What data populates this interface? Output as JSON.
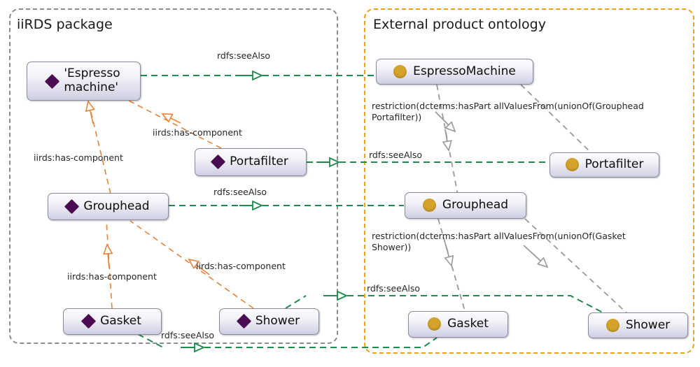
{
  "diagram": {
    "title": "iiRDS package and external product ontology mapping",
    "colors": {
      "iirds_package_border": "#8c8c8c",
      "external_package_border": "#e8a317",
      "see_also_edge": "#1f8b4d",
      "has_component_edge": "#e8833a",
      "restriction_edge": "#9a9a9a",
      "iirds_node_glyph": "#4b0b52",
      "ontology_node_glyph": "#d5a32b"
    }
  },
  "packages": [
    {
      "id": "iirds",
      "title": "iiRDS package"
    },
    {
      "id": "external",
      "title": "External product ontology"
    }
  ],
  "nodes": [
    {
      "id": "iirds_espresso",
      "label": "'Espresso\nmachine'",
      "package": "iirds",
      "glyph": "diamond-icon"
    },
    {
      "id": "iirds_portafilter",
      "label": "Portafilter",
      "package": "iirds",
      "glyph": "diamond-icon"
    },
    {
      "id": "iirds_grouphead",
      "label": "Grouphead",
      "package": "iirds",
      "glyph": "diamond-icon"
    },
    {
      "id": "iirds_gasket",
      "label": "Gasket",
      "package": "iirds",
      "glyph": "diamond-icon"
    },
    {
      "id": "iirds_shower",
      "label": "Shower",
      "package": "iirds",
      "glyph": "diamond-icon"
    },
    {
      "id": "ext_espresso",
      "label": "EspressoMachine",
      "package": "external",
      "glyph": "circle-icon"
    },
    {
      "id": "ext_portafilter",
      "label": "Portafilter",
      "package": "external",
      "glyph": "circle-icon"
    },
    {
      "id": "ext_grouphead",
      "label": "Grouphead",
      "package": "external",
      "glyph": "circle-icon"
    },
    {
      "id": "ext_gasket",
      "label": "Gasket",
      "package": "external",
      "glyph": "circle-icon"
    },
    {
      "id": "ext_shower",
      "label": "Shower",
      "package": "external",
      "glyph": "circle-icon"
    }
  ],
  "edge_labels": {
    "see_also_espresso": "rdfs:seeAlso",
    "see_also_portafilter": "rdfs:seeAlso",
    "see_also_grouphead": "rdfs:seeAlso",
    "see_also_shower": "rdfs:seeAlso",
    "see_also_gasket": "rdfs:seeAlso",
    "has_component_espresso_grouphead": "iirds:has-component",
    "has_component_espresso_portafilter": "iirds:has-component",
    "has_component_grouphead_gasket": "iirds:has-component",
    "has_component_grouphead_shower": "iirds:has-component",
    "restriction_espresso": "restriction(dcterms:hasPart allValuesFrom(unionOf(Grouphead\nPortafilter))",
    "restriction_grouphead": "restriction(dcterms:hasPart allValuesFrom(unionOf(Gasket\nShower))"
  }
}
